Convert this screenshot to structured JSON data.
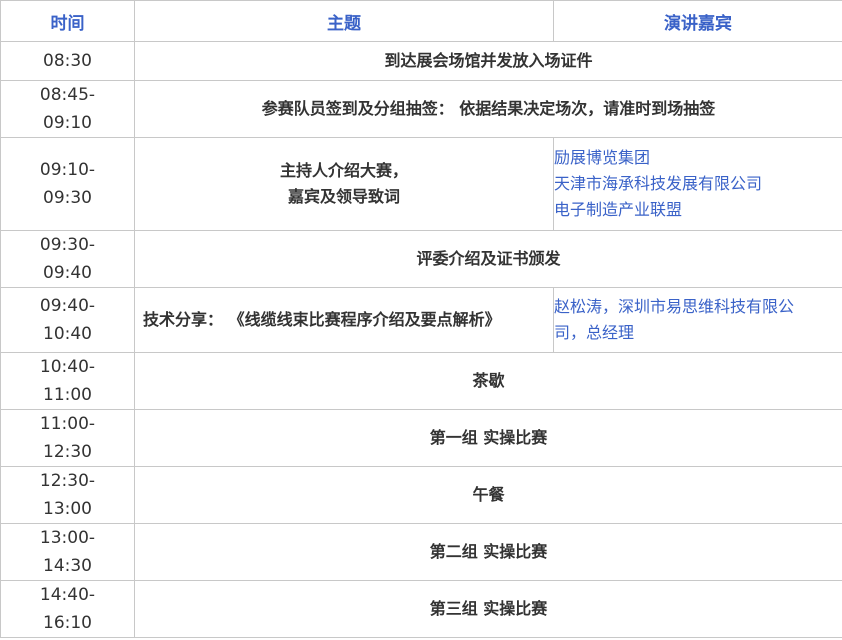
{
  "header": {
    "time": "时间",
    "topic": "主题",
    "speaker": "演讲嘉宾"
  },
  "rows": [
    {
      "time_start": "08:30",
      "time_end": "",
      "topic": "到达展会场馆并发放入场证件"
    },
    {
      "time_start": "08:45-",
      "time_end": "09:10",
      "topic": "参赛队员签到及分组抽签： 依据结果决定场次，请准时到场抽签"
    },
    {
      "time_start": "09:10-",
      "time_end": "09:30",
      "topic_line1": "主持人介绍大赛，",
      "topic_line2": "嘉宾及领导致词",
      "speakers": [
        "励展博览集团",
        "天津市海承科技发展有限公司",
        "电子制造产业联盟"
      ]
    },
    {
      "time_start": "09:30-",
      "time_end": "09:40",
      "topic": "评委介绍及证书颁发"
    },
    {
      "time_start": "09:40-",
      "time_end": "10:40",
      "topic": "技术分享： 《线缆线束比赛程序介绍及要点解析》",
      "speaker_line1": "赵松涛，深圳市易思维科技有限公",
      "speaker_line2": "司，总经理"
    },
    {
      "time_start": "10:40-",
      "time_end": "11:00",
      "topic": "茶歇"
    },
    {
      "time_start": "11:00-",
      "time_end": "12:30",
      "topic": "第一组 实操比赛"
    },
    {
      "time_start": "12:30-",
      "time_end": "13:00",
      "topic": "午餐"
    },
    {
      "time_start": "13:00-",
      "time_end": "14:30",
      "topic": "第二组 实操比赛"
    },
    {
      "time_start": "14:40-",
      "time_end": "16:10",
      "topic": "第三组 实操比赛"
    }
  ],
  "colors": {
    "header_text": "#3a62c8",
    "speaker_text": "#3a62c8",
    "body_text": "#333333",
    "border": "#c8c8c8"
  }
}
